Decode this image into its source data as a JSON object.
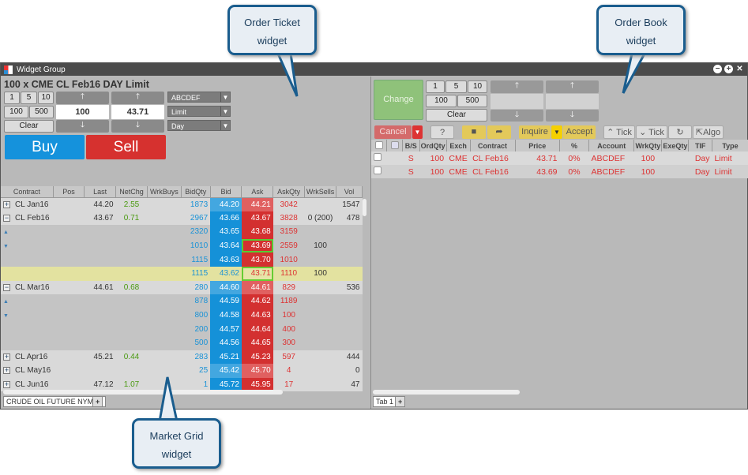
{
  "window": {
    "title": "Widget Group"
  },
  "callouts": {
    "ticket": [
      "Order Ticket",
      "widget"
    ],
    "book": [
      "Order Book",
      "widget"
    ],
    "grid": [
      "Market Grid",
      "widget"
    ]
  },
  "ticket": {
    "title": "100 x CME CL Feb16 DAY Limit",
    "qty_buttons": [
      "1",
      "5",
      "10",
      "100",
      "500"
    ],
    "clear": "Clear",
    "qty": "100",
    "price": "43.71",
    "account": "ABCDEF",
    "order_type": "Limit",
    "tif": "Day",
    "buy": "Buy",
    "sell": "Sell"
  },
  "grid": {
    "columns": [
      "Contract",
      "Pos",
      "Last",
      "NetChg",
      "WrkBuys",
      "BidQty",
      "Bid",
      "Ask",
      "AskQty",
      "WrkSells",
      "Vol"
    ],
    "rows": [
      {
        "k": "c",
        "exp": "+",
        "contract": "CL Jan16",
        "last": "44.20",
        "netchg": "2.55",
        "bidqty": "1873",
        "bid": "44.20",
        "ask": "44.21",
        "askqty": "3042",
        "wrksells": "",
        "vol": "1547",
        "lite": true
      },
      {
        "k": "c",
        "exp": "−",
        "contract": "CL Feb16",
        "last": "43.67",
        "netchg": "0.71",
        "bidqty": "2967",
        "bid": "43.66",
        "ask": "43.67",
        "askqty": "3828",
        "wrksells": "0 (200)",
        "vol": "478"
      },
      {
        "k": "d",
        "arrow": "▲",
        "bidqty": "2320",
        "bid": "43.65",
        "ask": "43.68",
        "askqty": "3159"
      },
      {
        "k": "d",
        "arrow": "▼",
        "bidqty": "1010",
        "bid": "43.64",
        "ask": "43.69",
        "askqty": "2559",
        "wrksells": "100",
        "hl": true
      },
      {
        "k": "d",
        "bidqty": "1115",
        "bid": "43.63",
        "ask": "43.70",
        "askqty": "1010"
      },
      {
        "k": "y",
        "bidqty": "1115",
        "bid": "43.62",
        "ask": "43.71",
        "askqty": "1110",
        "wrksells": "100"
      },
      {
        "k": "c",
        "exp": "−",
        "contract": "CL Mar16",
        "last": "44.61",
        "netchg": "0.68",
        "bidqty": "280",
        "bid": "44.60",
        "ask": "44.61",
        "askqty": "829",
        "vol": "536",
        "lite": true
      },
      {
        "k": "d",
        "arrow": "▲",
        "bidqty": "878",
        "bid": "44.59",
        "ask": "44.62",
        "askqty": "1189"
      },
      {
        "k": "d",
        "arrow": "▼",
        "bidqty": "800",
        "bid": "44.58",
        "ask": "44.63",
        "askqty": "100"
      },
      {
        "k": "d",
        "bidqty": "200",
        "bid": "44.57",
        "ask": "44.64",
        "askqty": "400"
      },
      {
        "k": "d",
        "bidqty": "500",
        "bid": "44.56",
        "ask": "44.65",
        "askqty": "300"
      },
      {
        "k": "c",
        "exp": "+",
        "contract": "CL Apr16",
        "last": "45.21",
        "netchg": "0.44",
        "bidqty": "283",
        "bid": "45.21",
        "ask": "45.23",
        "askqty": "597",
        "vol": "444"
      },
      {
        "k": "c",
        "exp": "+",
        "contract": "CL May16",
        "bidqty": "25",
        "bid": "45.42",
        "ask": "45.70",
        "askqty": "4",
        "vol": "0",
        "lite": true
      },
      {
        "k": "c",
        "exp": "+",
        "contract": "CL Jun16",
        "last": "47.12",
        "netchg": "1.07",
        "bidqty": "1",
        "bid": "45.72",
        "ask": "45.95",
        "askqty": "17",
        "vol": "47"
      }
    ],
    "tab": "CRUDE OIL FUTURE NYMEX",
    "add_tab": "+"
  },
  "book": {
    "change": "Change",
    "qty_buttons": [
      "1",
      "5",
      "10",
      "100",
      "500"
    ],
    "clear": "Clear",
    "toolbar": {
      "cancel": "Cancel",
      "help": "?",
      "inquire": "Inquire",
      "accept": "Accept",
      "tick_up": "Tick",
      "tick_down": "Tick",
      "algo": "Algo"
    },
    "columns": [
      "B/S",
      "OrdQty",
      "Exch",
      "Contract",
      "Price",
      "%",
      "Account",
      "WrkQty",
      "ExeQty",
      "TIF",
      "Type"
    ],
    "orders": [
      {
        "bs": "S",
        "qty": "100",
        "exch": "CME",
        "contract": "CL Feb16",
        "price": "43.71",
        "pct": "0%",
        "account": "ABCDEF",
        "wrk": "100",
        "exe": "",
        "tif": "Day",
        "type": "Limit"
      },
      {
        "bs": "S",
        "qty": "100",
        "exch": "CME",
        "contract": "CL Feb16",
        "price": "43.69",
        "pct": "0%",
        "account": "ABCDEF",
        "wrk": "100",
        "exe": "",
        "tif": "Day",
        "type": "Limit"
      }
    ],
    "tab": "Tab 1",
    "add_tab": "+"
  }
}
